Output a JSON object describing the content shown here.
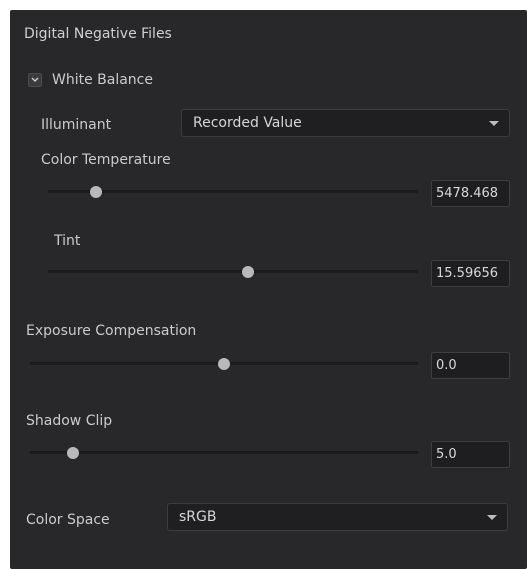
{
  "section": {
    "title": "Digital Negative Files"
  },
  "white_balance": {
    "checkbox_label": "White Balance",
    "illuminant": {
      "label": "Illuminant",
      "value": "Recorded Value"
    },
    "color_temperature": {
      "label": "Color Temperature",
      "value": "5478.468",
      "slider_fraction": 0.13
    },
    "tint": {
      "label": "Tint",
      "value": "15.59656",
      "slider_fraction": 0.54
    }
  },
  "exposure_compensation": {
    "label": "Exposure Compensation",
    "value": "0.0",
    "slider_fraction": 0.5
  },
  "shadow_clip": {
    "label": "Shadow Clip",
    "value": "5.0",
    "slider_fraction": 0.11
  },
  "color_space": {
    "label": "Color Space",
    "value": "sRGB"
  },
  "colors": {
    "panel_bg": "#28282b",
    "field_bg": "#1f1f21",
    "thumb": "#b9b9b9",
    "text": "#cbcbcb"
  },
  "icons": {
    "checkbox": "chevron-down-icon",
    "dropdown": "caret-down-icon"
  }
}
